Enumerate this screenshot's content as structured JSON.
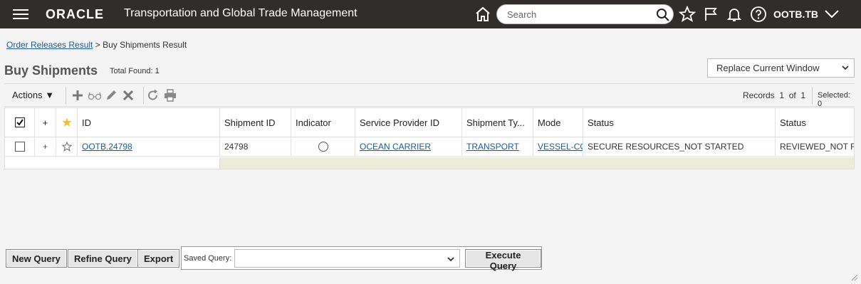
{
  "header": {
    "logo": "ORACLE",
    "title": "Transportation and Global Trade Management",
    "search_placeholder": "Search",
    "user": "OOTB.TB"
  },
  "breadcrumb": {
    "parent": "Order Releases Result",
    "separator": ">",
    "current": "Buy Shipments Result"
  },
  "page": {
    "title": "Buy Shipments",
    "total_found": "Total Found: 1",
    "window_option": "Replace Current Window"
  },
  "toolbar": {
    "actions_label": "Actions",
    "records_label": "Records",
    "records_current": "1",
    "records_of": "of",
    "records_total": "1",
    "selected_label": "Selected:",
    "selected_count": "0"
  },
  "table": {
    "headers": {
      "plus": "+",
      "id": "ID",
      "shipment_id": "Shipment ID",
      "indicator": "Indicator",
      "service_provider": "Service Provider ID",
      "shipment_type": "Shipment Ty...",
      "mode": "Mode",
      "status": "Status",
      "status2": "Status"
    },
    "rows": [
      {
        "plus": "+",
        "id": "OOTB.24798",
        "shipment_id": "24798",
        "service_provider": "OCEAN CARRIER",
        "shipment_type": "TRANSPORT",
        "mode": "VESSEL-CO",
        "status": "SECURE RESOURCES_NOT STARTED",
        "status2": "REVIEWED_NOT REV"
      }
    ]
  },
  "buttons": {
    "new_query": "New Query",
    "refine_query": "Refine Query",
    "export": "Export",
    "saved_query_label": "Saved Query:",
    "execute_query": "Execute Query"
  },
  "colors": {
    "header_bg": "#312d2a",
    "link": "#1a5b9a",
    "filler": "#ecedd9",
    "star": "#f0c040"
  }
}
